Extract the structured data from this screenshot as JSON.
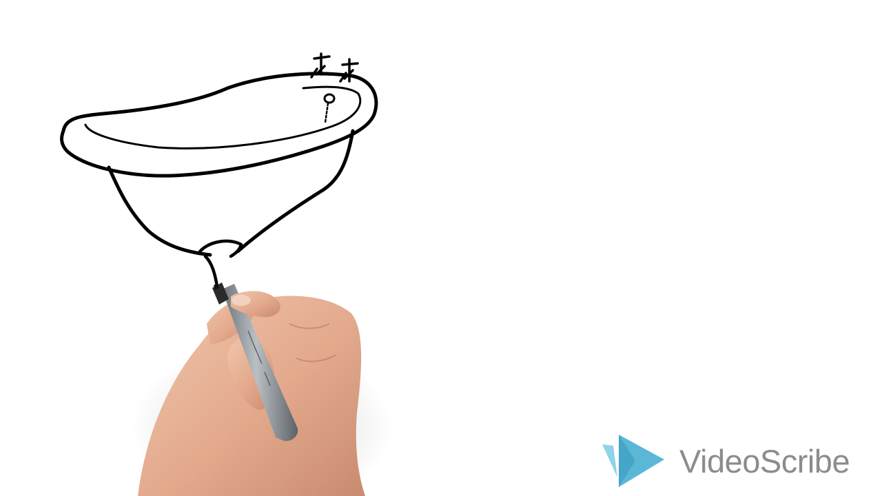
{
  "scene": {
    "background_color": "#ffffff",
    "ink_color": "#000000",
    "subject_icon": "clawfoot-bathtub-sketch-icon",
    "hand_icon": "hand-with-marker-icon"
  },
  "watermark": {
    "brand": "VideoScribe",
    "logo_icon": "videoscribe-logo-icon",
    "text_color": "#8c8c8c",
    "logo_colors": [
      "#5ab8d6",
      "#8fd3e8",
      "#3a9cc0"
    ]
  }
}
